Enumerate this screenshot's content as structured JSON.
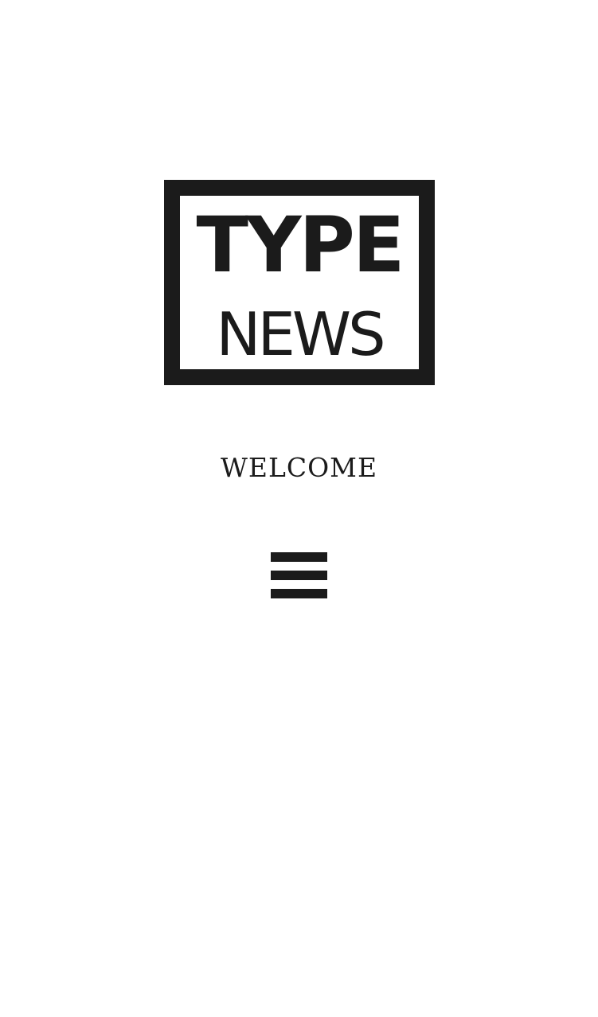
{
  "logo": {
    "line1": "TYPE",
    "line2": "NEWS"
  },
  "welcome_text": "WELCOME",
  "menu": {
    "icon": "hamburger-menu-icon"
  },
  "colors": {
    "ink": "#1b1b1b",
    "background": "#ffffff"
  }
}
